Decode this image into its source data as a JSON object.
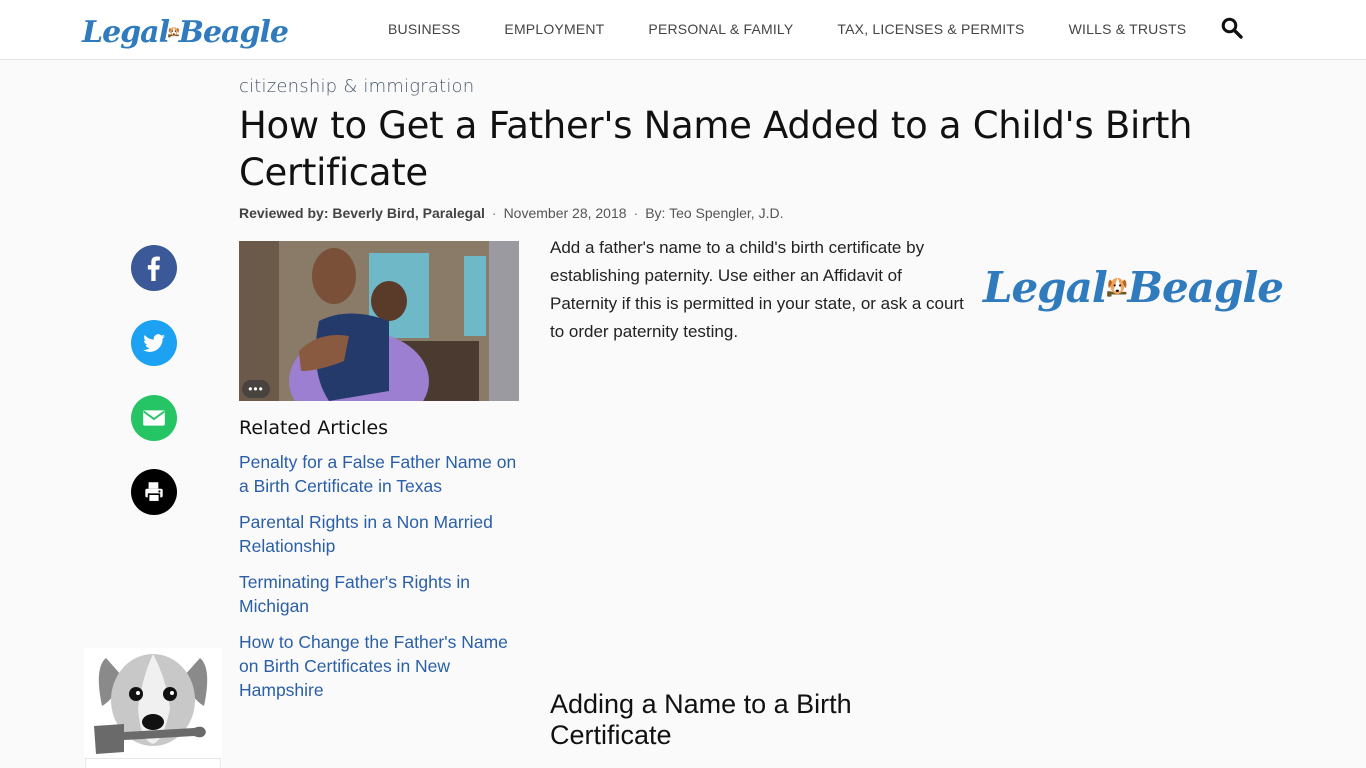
{
  "header": {
    "logo": {
      "left": "Legal",
      "right": "Beagle"
    },
    "nav": [
      "BUSINESS",
      "EMPLOYMENT",
      "PERSONAL & FAMILY",
      "TAX, LICENSES & PERMITS",
      "WILLS & TRUSTS"
    ],
    "search_icon": "search-icon"
  },
  "article": {
    "category": "citizenship & immigration",
    "title": "How to Get a Father's Name Added to a Child's Birth Certificate",
    "reviewed_by": "Reviewed by: Beverly Bird, Paralegal",
    "date": "November 28, 2018",
    "author": "By: Teo Spengler, J.D.",
    "separator": "·",
    "intro": "Add a father's name to a child's birth certificate by establishing paternity. Use either an Affidavit of Paternity if this is permitted in your state, or ask a court to order paternity testing.",
    "image_more_label": "•••",
    "subheading": "Adding a Name to a Birth Certificate"
  },
  "share": [
    {
      "name": "facebook",
      "icon": "facebook-icon",
      "color": "#3b5998"
    },
    {
      "name": "twitter",
      "icon": "twitter-icon",
      "color": "#1da1f2"
    },
    {
      "name": "email",
      "icon": "email-icon",
      "color": "#25c464"
    },
    {
      "name": "print",
      "icon": "print-icon",
      "color": "#000000"
    }
  ],
  "related": {
    "heading": "Related Articles",
    "items": [
      "Penalty for a False Father Name on a Birth Certificate in Texas",
      "Parental Rights in a Non Married Relationship",
      "Terminating Father's Rights in Michigan",
      "How to Change the Father's Name on Birth Certificates in New Hampshire"
    ]
  },
  "side_logo": {
    "left": "Legal",
    "right": "Beagle"
  },
  "colors": {
    "brand_blue": "#2f7bbd",
    "link": "#2a5fa8",
    "dog_orange": "#f0a050"
  }
}
